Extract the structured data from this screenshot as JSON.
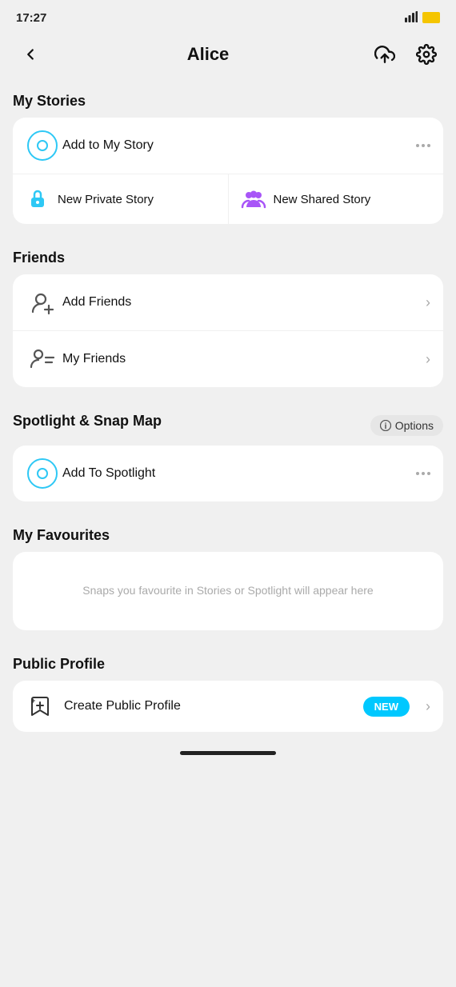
{
  "statusBar": {
    "time": "17:27",
    "batteryColor": "#f5c500"
  },
  "header": {
    "title": "Alice",
    "backLabel": "back",
    "uploadLabel": "upload",
    "settingsLabel": "settings"
  },
  "myStories": {
    "sectionTitle": "My Stories",
    "addToMyStory": "Add to My Story",
    "newPrivateStory": "New Private Story",
    "newSharedStory": "New Shared Story"
  },
  "friends": {
    "sectionTitle": "Friends",
    "addFriends": "Add Friends",
    "myFriends": "My Friends"
  },
  "spotlightSnapMap": {
    "sectionTitle": "Spotlight & Snap Map",
    "optionsLabel": "Options",
    "addToSpotlight": "Add To Spotlight"
  },
  "myFavourites": {
    "sectionTitle": "My Favourites",
    "emptyText": "Snaps you favourite in Stories or Spotlight will appear here"
  },
  "publicProfile": {
    "sectionTitle": "Public Profile",
    "createLabel": "Create Public Profile",
    "newBadge": "NEW"
  }
}
